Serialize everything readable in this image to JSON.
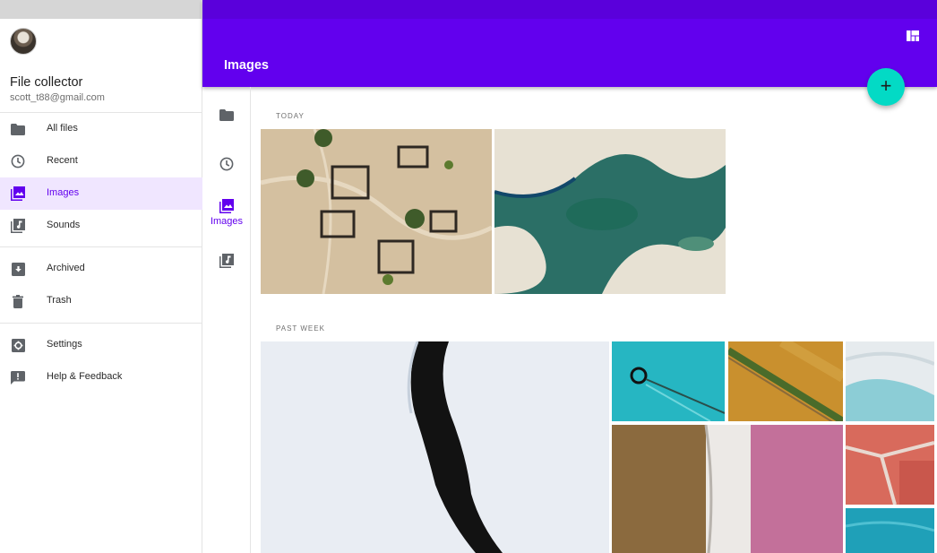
{
  "drawer": {
    "user": {
      "name": "File collector",
      "email": "scott_t88@gmail.com"
    },
    "items": [
      {
        "label": "All files",
        "icon": "folder-icon"
      },
      {
        "label": "Recent",
        "icon": "clock-icon"
      },
      {
        "label": "Images",
        "icon": "image-icon",
        "active": true
      },
      {
        "label": "Sounds",
        "icon": "audio-library-icon"
      },
      {
        "label": "Archived",
        "icon": "archive-icon"
      },
      {
        "label": "Trash",
        "icon": "trash-icon"
      },
      {
        "label": "Settings",
        "icon": "gear-icon"
      },
      {
        "label": "Help & Feedback",
        "icon": "feedback-icon"
      }
    ]
  },
  "appbar": {
    "title": "Images",
    "view_toggle_icon": "view-quilt-icon"
  },
  "fab": {
    "label": "+",
    "icon": "add-icon"
  },
  "rail": {
    "active_label": "Images"
  },
  "sections": [
    {
      "title": "TODAY"
    },
    {
      "title": "PAST WEEK"
    }
  ],
  "colors": {
    "primary": "#6200ee",
    "secondary": "#03dac5",
    "active_bg": "#f0e6ff"
  }
}
